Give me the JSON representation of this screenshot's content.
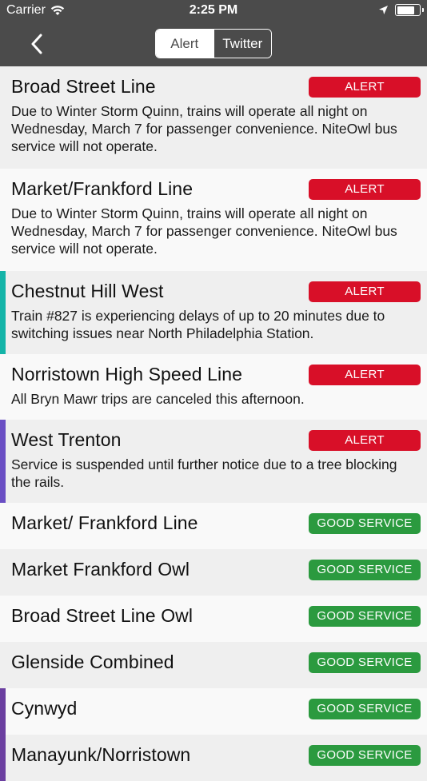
{
  "status_bar": {
    "carrier": "Carrier",
    "time": "2:25 PM",
    "battery_level": 0.9,
    "icons": [
      "wifi-icon",
      "location-arrow-icon",
      "battery-icon"
    ]
  },
  "nav": {
    "back_icon": "chevron-left-icon",
    "tabs": [
      {
        "label": "Alert",
        "selected": true
      },
      {
        "label": "Twitter",
        "selected": false
      }
    ]
  },
  "colors": {
    "alert": "#d80f28",
    "good_service": "#2b9a3f",
    "header": "#4b4b4b",
    "accent_teal": "#14b4a8",
    "accent_purple": "#6a4fc4",
    "accent_violet": "#6b3fa0"
  },
  "lines": [
    {
      "name": "Broad Street Line",
      "status": "ALERT",
      "description": "Due to Winter Storm Quinn, trains will operate all night on Wednesday, March 7 for passenger convenience.  NiteOwl bus service will not operate.",
      "accent": ""
    },
    {
      "name": "Market/Frankford Line",
      "status": "ALERT",
      "description": "Due to Winter Storm Quinn, trains will operate all night on Wednesday, March 7 for passenger convenience.  NiteOwl bus service will not operate.",
      "accent": ""
    },
    {
      "name": "Chestnut Hill West",
      "status": "ALERT",
      "description": "Train #827 is experiencing delays of up to 20 minutes due to switching issues near North Philadelphia Station.",
      "accent": "#14b4a8"
    },
    {
      "name": "Norristown High Speed Line",
      "status": "ALERT",
      "description": "All Bryn Mawr  trips are canceled this afternoon.",
      "accent": ""
    },
    {
      "name": "West Trenton",
      "status": "ALERT",
      "description": "Service is suspended until further notice due to a tree blocking the rails.",
      "accent": "#6a4fc4"
    },
    {
      "name": "Market/ Frankford Line",
      "status": "GOOD SERVICE",
      "description": "",
      "accent": ""
    },
    {
      "name": "Market Frankford Owl",
      "status": "GOOD SERVICE",
      "description": "",
      "accent": ""
    },
    {
      "name": "Broad Street Line Owl",
      "status": "GOOD SERVICE",
      "description": "",
      "accent": ""
    },
    {
      "name": "Glenside Combined",
      "status": "GOOD SERVICE",
      "description": "",
      "accent": ""
    },
    {
      "name": "Cynwyd",
      "status": "GOOD SERVICE",
      "description": "",
      "accent": "#6b3fa0"
    },
    {
      "name": "Manayunk/Norristown",
      "status": "GOOD SERVICE",
      "description": "",
      "accent": "#6b3fa0"
    }
  ]
}
